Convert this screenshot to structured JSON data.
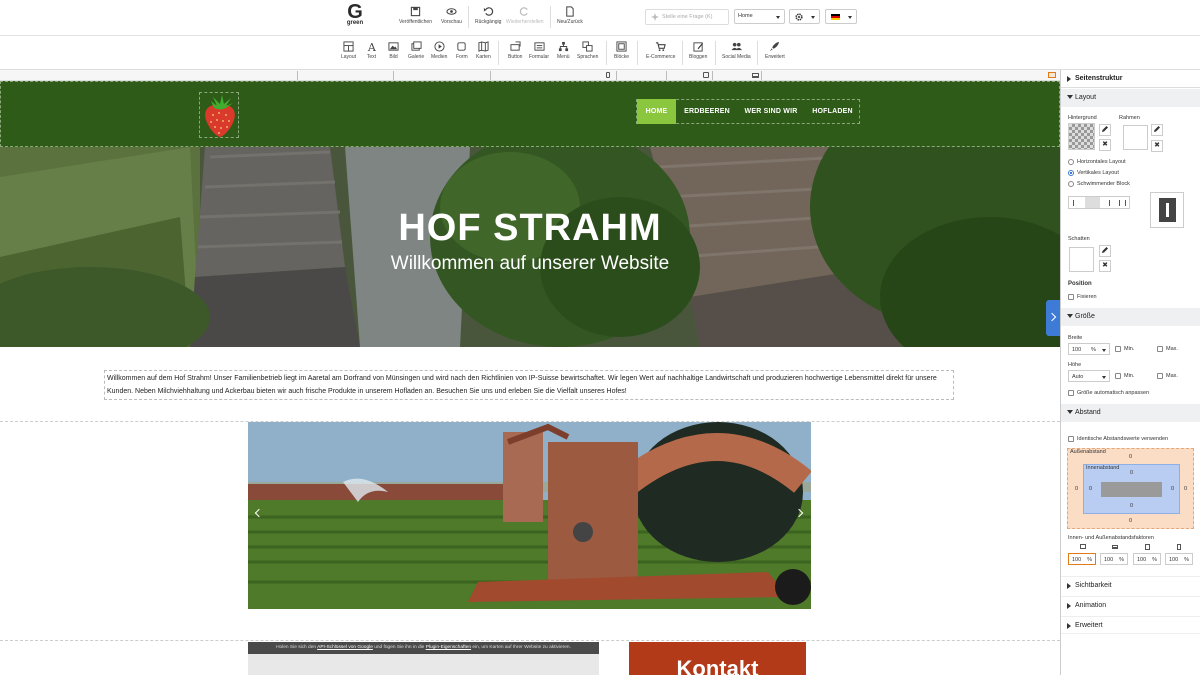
{
  "app": {
    "logo_glyph": "G",
    "logo_text": "green"
  },
  "topbar": {
    "publish": "Veröffentlichen",
    "preview": "Vorschau",
    "undo": "Rückgängig",
    "redo": "Wiederherstellen",
    "new_back": "Neu/Zurück",
    "search_placeholder": "Stelle eine Frage (K)",
    "page_select": "Home"
  },
  "toolbar": {
    "items": [
      "Layout",
      "Text",
      "Bild",
      "Galerie",
      "Medien",
      "Form",
      "Karten",
      "Button",
      "Formular",
      "Menü",
      "Sprachen",
      "Blöcke",
      "E-Commerce",
      "Bloggen",
      "Social Media",
      "Erweitert"
    ]
  },
  "site": {
    "nav": [
      "HOME",
      "ERDBEEREN",
      "WER SIND WIR",
      "HOFLADEN"
    ],
    "hero_title": "HOF STRAHM",
    "hero_subtitle": "Willkommen auf unserer Website",
    "intro": "Willkommen auf dem Hof Strahm! Unser Familienbetrieb liegt im Aaretal am Dorfrand von Münsingen und wird nach den Richtlinien von IP-Suisse bewirtschaftet. Wir legen Wert auf nachhaltige Landwirtschaft und produzieren hochwertige Lebensmittel direkt für unsere Kunden. Neben Milchviehhaltung und Ackerbau bieten wir auch frische Produkte in unserem Hofladen an. Besuchen Sie uns und erleben Sie die Vielfalt unseres Hofes!",
    "map_note_pre": "Holen Sie sich den ",
    "map_note_link1": "API-Schlüssel von Google",
    "map_note_mid": " und fügen Sie ihn in die ",
    "map_note_link2": "Plugin-Eigenschaften",
    "map_note_post": " ein, um Karten auf Ihrer Website zu aktivieren.",
    "kontakt": "Kontakt"
  },
  "panel": {
    "title": "Seitenstruktur",
    "layout": "Layout",
    "hintergrund": "Hintergrund",
    "rahmen": "Rahmen",
    "layout_options": [
      "Horizontales Layout",
      "Vertikales Layout",
      "Schwimmender Block"
    ],
    "schatten": "Schatten",
    "position": "Position",
    "fixieren": "Fixieren",
    "groesse": "Größe",
    "breite": "Breite",
    "breite_value": "100",
    "breite_unit": "%",
    "min": "Min.",
    "max": "Max.",
    "hoehe": "Höhe",
    "hoehe_value": "Auto",
    "auto_size": "Größe automatisch anpassen",
    "abstand": "Abstand",
    "identical": "Identische Abstandswerte verwenden",
    "aussen": "Außenabstand",
    "innen": "Innenabstand",
    "zero": "0",
    "factors": "Innen- und Außenabstandsfaktoren",
    "factor_values": [
      "100",
      "100",
      "100",
      "100"
    ],
    "factor_unit": "%",
    "sichtbarkeit": "Sichtbarkeit",
    "animation": "Animation",
    "erweitert": "Erweitert"
  }
}
